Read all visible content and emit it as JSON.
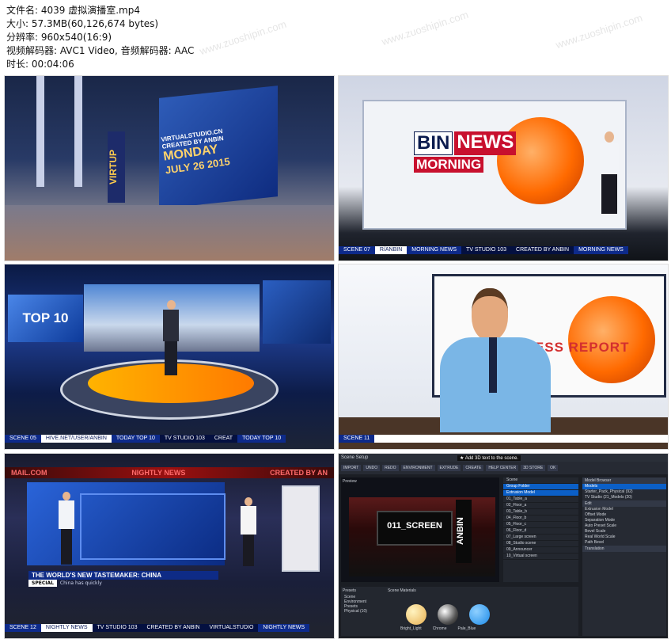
{
  "header": {
    "lines": [
      "文件名: 4039 虚拟演播室.mp4",
      "大小: 57.3MB(60,126,674 bytes)",
      "分辨率: 960x540(16:9)",
      "视频解码器: AVC1 Video, 音频解码器: AAC",
      "时长: 00:04:06"
    ]
  },
  "watermark": "www.zuoshipin.com",
  "thumb1": {
    "site": "VIRTUALSTUDIO.CN",
    "byline": "CREATED BY ANBIN",
    "day": "MONDAY",
    "date": "JULY 26 2015",
    "vertical": "VIRTUP"
  },
  "thumb2": {
    "logo_bin": "BIN",
    "logo_news": "NEWS",
    "logo_morning": "MORNING",
    "ticker": [
      "SCENE 07",
      "R/ANBIN",
      "MORNING NEWS",
      "TV STUDIO 103",
      "CREATED BY ANBIN",
      "MORNING NEWS"
    ]
  },
  "thumb3": {
    "top10": "TOP 10",
    "ticker": [
      "SCENE 05",
      "HIVE.NET/USER/ANBIN",
      "TODAY TOP 10",
      "TV STUDIO 103",
      "CREAT",
      "TODAY TOP 10"
    ]
  },
  "thumb4": {
    "report": "BUSINESS REPORT",
    "ticker": [
      "SCENE 11",
      ""
    ]
  },
  "thumb5": {
    "banner_left": "MAIL.COM",
    "banner_mid": "NIGHTLY NEWS",
    "banner_right": "CREATED BY AN",
    "headline": "THE WORLD'S NEW TASTEMAKER: CHINA",
    "special": "SPECIAL",
    "sub": "China has quickly",
    "ticker": [
      "SCENE 12",
      "NIGHTLY NEWS",
      "TV STUDIO 103",
      "CREATED BY ANBIN",
      "VIRTUALSTUDIO",
      "NIGHTLY NEWS"
    ]
  },
  "thumb6": {
    "title": "Scene Setup",
    "tooltip": "★ Add 3D text to the scene.",
    "toolbar": [
      "IMPORT",
      "UNDO",
      "REDO",
      "ENVIRONMENT",
      "EXTRUDE",
      "CREATE",
      "HELP CENTER",
      "3D STORE",
      "OK"
    ],
    "preview_label": "Preview",
    "screen_text": "011_SCREEN",
    "anbin": "ANBIN",
    "scene_label": "Scene",
    "scene_rows": [
      "Group Folder",
      "Extrusion Model",
      "01_Table_a",
      "02_Floor_a",
      "03_Table_b",
      "04_Floor_b",
      "05_Floor_c",
      "06_Floor_d",
      "07_Large screen",
      "08_Studio scene",
      "09_Announcer",
      "10_Virtual screen"
    ],
    "model_browser": "Model Browser",
    "models": [
      "Models",
      "Starter_Pack_Physical (92)",
      "TV Studio (21_Models (20)"
    ],
    "edit_label": "Edit",
    "edit_rows": [
      "Extrusion Model",
      "Offset Mode",
      "Separation Mode",
      "Auto Preset Scale",
      "Bevel Scale",
      "Real World Scale",
      "Path Bevel"
    ],
    "translation": "Translation",
    "presets_label": "Presets",
    "scene_materials": "Scene Materials",
    "preset_tree": [
      "Scene",
      "Environment",
      "Presets",
      "Physical (10)"
    ],
    "materials": [
      "Bright_Light",
      "Chrome",
      "Pale_Blue"
    ]
  },
  "colors": {
    "news_red": "#c8102e",
    "studio_blue": "#0d2a8a",
    "globe_orange": "#ff6a00",
    "ui_select": "#0b5fc7"
  }
}
